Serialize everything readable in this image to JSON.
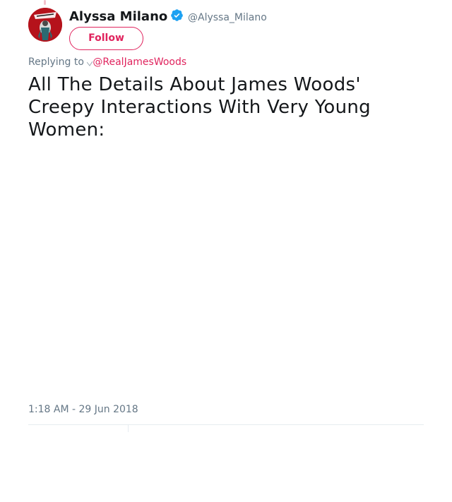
{
  "author": {
    "name": "Alyssa Milano",
    "handle": "@Alyssa_Milano",
    "verified": true
  },
  "follow_label": "Follow",
  "reply": {
    "prefix": "Replying to",
    "mention": "@RealJamesWoods"
  },
  "tweet_text": "All The Details About James Woods' Creepy Interactions With Very Young Women:",
  "timestamp": "1:18 AM - 29 Jun 2018",
  "colors": {
    "accent": "#e0245e",
    "verified_blue": "#1da1f2",
    "text": "#14171a",
    "muted": "#657786",
    "divider": "#e6ecf0"
  },
  "icons": {
    "verified": "verified-badge-icon"
  }
}
